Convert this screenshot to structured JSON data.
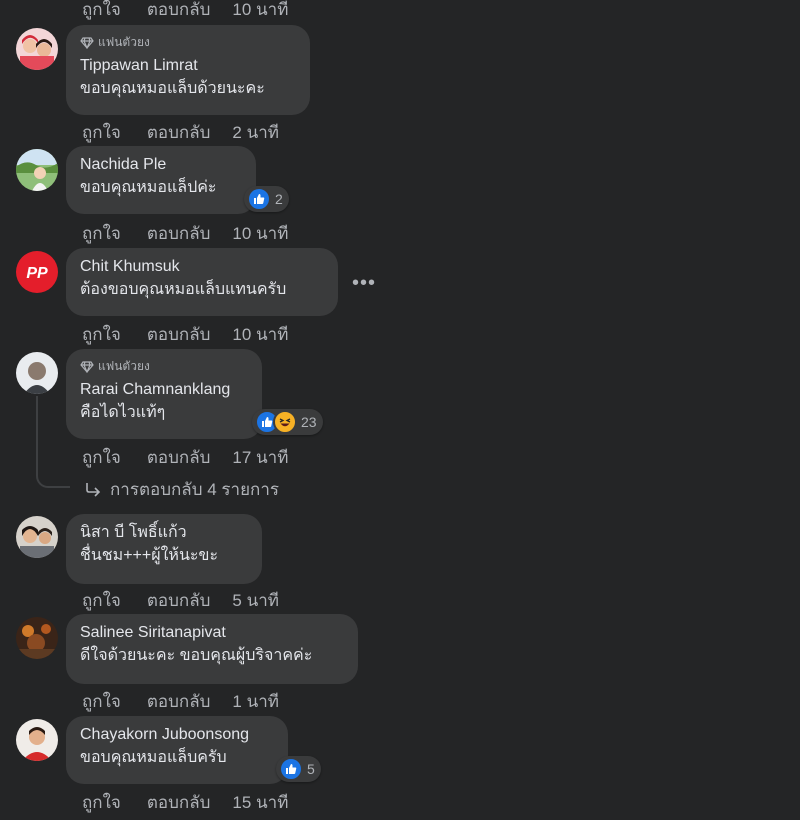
{
  "labels": {
    "like": "ถูกใจ",
    "reply": "ตอบกลับ"
  },
  "top_item": {
    "time": "10 นาที"
  },
  "comments": [
    {
      "author": "Tippawan Limrat",
      "badge": "แฟนตัวยง",
      "text": "ขอบคุณหมอแล็บด้วยนะคะ",
      "time": "2 นาที"
    },
    {
      "author": "Nachida Ple",
      "text": "ขอบคุณหมอแล็ปค่ะ",
      "time": "10 นาที",
      "reaction_count": "2"
    },
    {
      "author": "Chit Khumsuk",
      "text": "ต้องขอบคุณหมอแล็บแทนครับ",
      "time": "10 นาที"
    },
    {
      "author": "Rarai Chamnanklang",
      "badge": "แฟนตัวยง",
      "text": "คือไดไวแท้ๆ",
      "time": "17 นาที",
      "reaction_count": "23",
      "replies_link": "การตอบกลับ 4 รายการ"
    },
    {
      "author": "นิสา บี โพธิ์แก้ว",
      "text": "ชื่นชม+++ผู้ให้นะขะ",
      "time": "5 นาที"
    },
    {
      "author": "Salinee Siritanapivat",
      "text": "ดีใจด้วยนะคะ ขอบคุณผู้บริจาคค่ะ",
      "time": "1 นาที"
    },
    {
      "author": "Chayakorn Juboonsong",
      "text": "ขอบคุณหมอแล็บครับ",
      "time": "15 นาที",
      "reaction_count": "5"
    }
  ],
  "colors": {
    "background": "#242526",
    "bubble": "#3a3b3c",
    "like_blue": "#1b74e4",
    "haha_yellow": "#f7b125",
    "pp_red": "#e41e2b"
  }
}
